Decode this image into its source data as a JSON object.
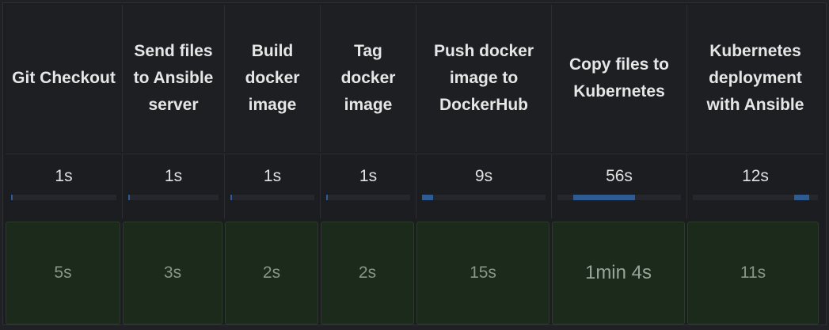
{
  "stages": [
    {
      "name": "Git Checkout",
      "avg": "1s",
      "avg_fill": 0.015,
      "avg_offset": 0.0,
      "run": "5s"
    },
    {
      "name": "Send files to Ansible server",
      "avg": "1s",
      "avg_fill": 0.015,
      "avg_offset": 0.0,
      "run": "3s"
    },
    {
      "name": "Build docker image",
      "avg": "1s",
      "avg_fill": 0.015,
      "avg_offset": 0.0,
      "run": "2s"
    },
    {
      "name": "Tag docker image",
      "avg": "1s",
      "avg_fill": 0.015,
      "avg_offset": 0.0,
      "run": "2s"
    },
    {
      "name": "Push docker image to DockerHub",
      "avg": "9s",
      "avg_fill": 0.09,
      "avg_offset": 0.0,
      "run": "15s"
    },
    {
      "name": "Copy files to Kubernetes",
      "avg": "56s",
      "avg_fill": 0.5,
      "avg_offset": 0.13,
      "run": "1min 4s"
    },
    {
      "name": "Kubernetes deployment with Ansible",
      "avg": "12s",
      "avg_fill": 0.12,
      "avg_offset": 0.81,
      "run": "11s"
    }
  ],
  "colors": {
    "background": "#1c1d20",
    "progress_fill": "#2f5b93",
    "run_success": "#1b2a1a"
  }
}
